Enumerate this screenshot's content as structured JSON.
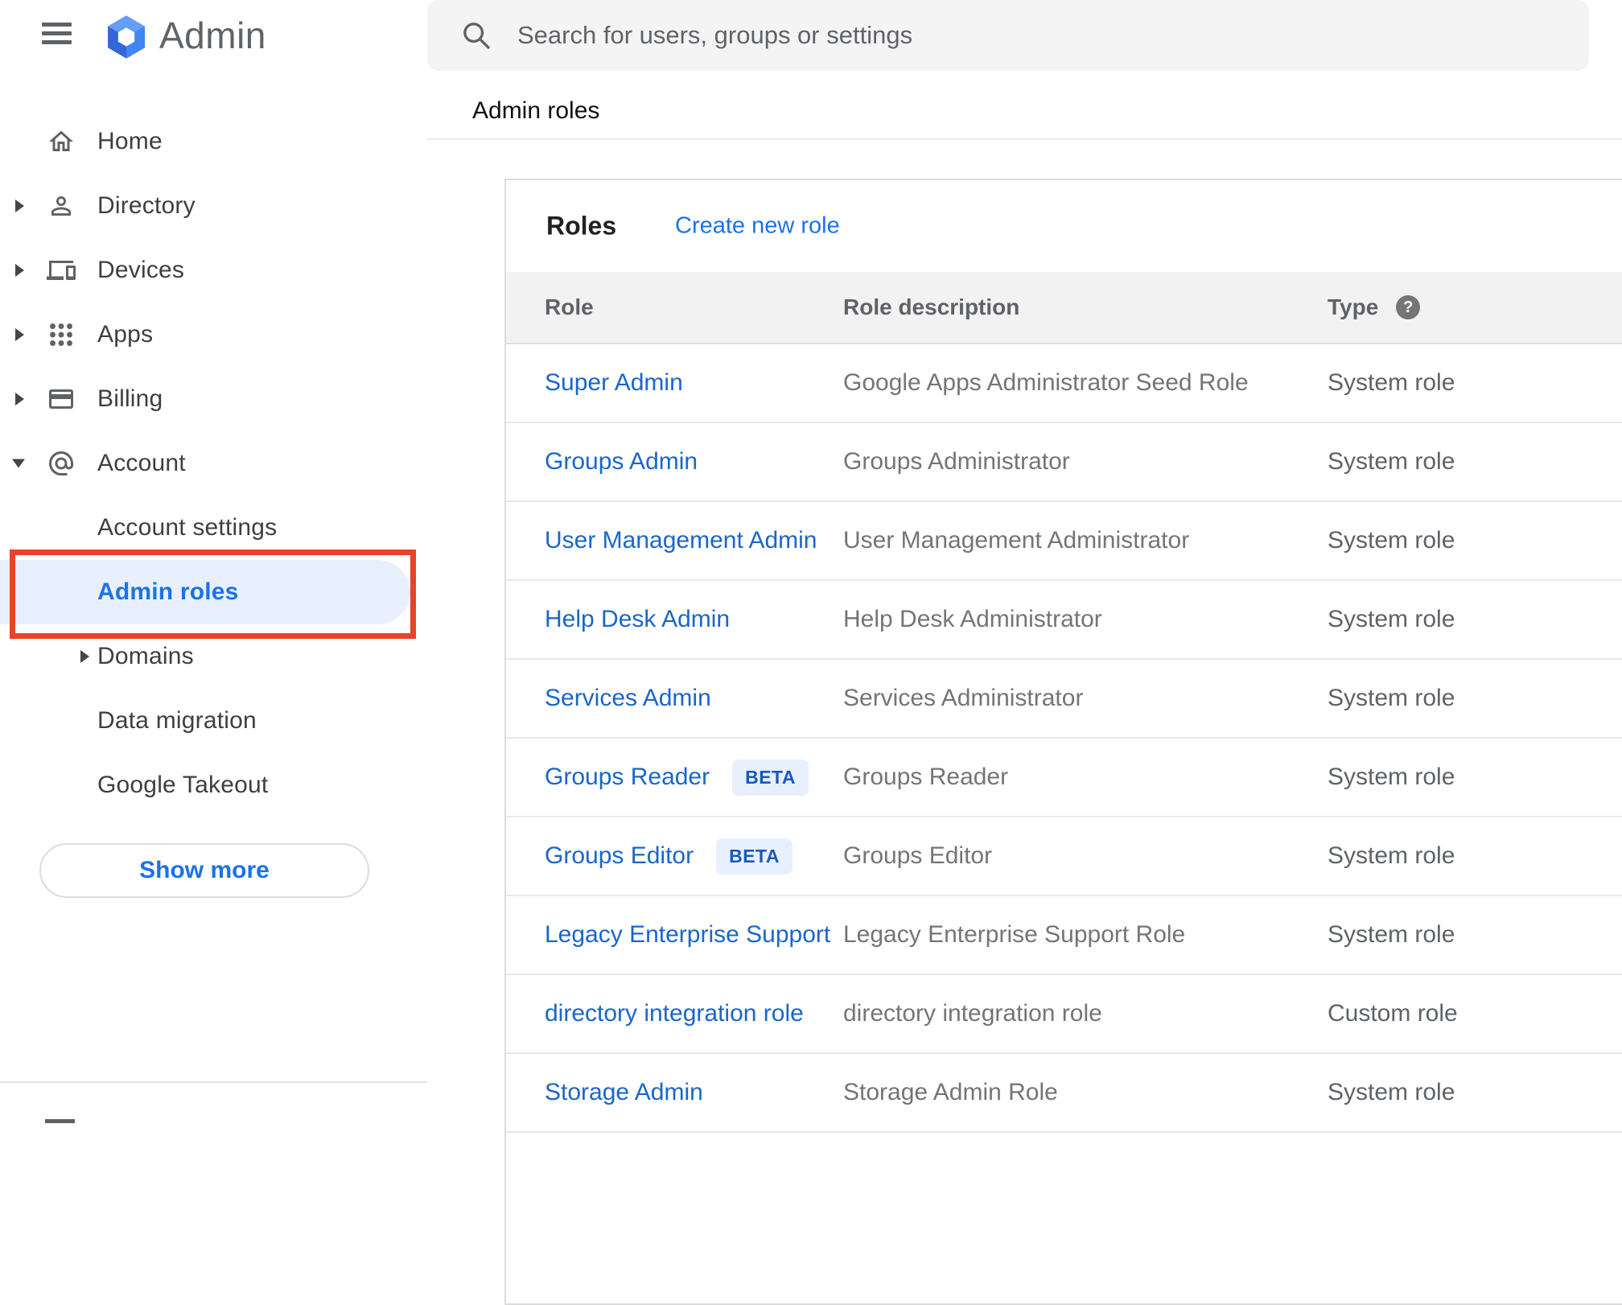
{
  "app": {
    "title": "Admin"
  },
  "search": {
    "placeholder": "Search for users, groups or settings"
  },
  "breadcrumb": "Admin roles",
  "sidebar": {
    "items": [
      {
        "label": "Home",
        "icon": "home-icon",
        "expandable": false
      },
      {
        "label": "Directory",
        "icon": "person-icon",
        "expandable": true
      },
      {
        "label": "Devices",
        "icon": "devices-icon",
        "expandable": true
      },
      {
        "label": "Apps",
        "icon": "apps-grid-icon",
        "expandable": true
      },
      {
        "label": "Billing",
        "icon": "credit-card-icon",
        "expandable": true
      },
      {
        "label": "Account",
        "icon": "at-email-icon",
        "expanded": true
      }
    ],
    "account_children": [
      {
        "label": "Account settings"
      },
      {
        "label": "Admin roles",
        "active": true
      },
      {
        "label": "Domains",
        "expandable": true
      },
      {
        "label": "Data migration"
      },
      {
        "label": "Google Takeout"
      }
    ],
    "show_more_label": "Show more"
  },
  "main": {
    "card_title": "Roles",
    "create_link": "Create new role",
    "table": {
      "columns": [
        "Role",
        "Role description",
        "Type"
      ],
      "beta_label": "BETA",
      "rows": [
        {
          "role": "Super Admin",
          "beta": false,
          "description": "Google Apps Administrator Seed Role",
          "type": "System role"
        },
        {
          "role": "Groups Admin",
          "beta": false,
          "description": "Groups Administrator",
          "type": "System role"
        },
        {
          "role": "User Management Admin",
          "beta": false,
          "description": "User Management Administrator",
          "type": "System role"
        },
        {
          "role": "Help Desk Admin",
          "beta": false,
          "description": "Help Desk Administrator",
          "type": "System role"
        },
        {
          "role": "Services Admin",
          "beta": false,
          "description": "Services Administrator",
          "type": "System role"
        },
        {
          "role": "Groups Reader",
          "beta": true,
          "description": "Groups Reader",
          "type": "System role"
        },
        {
          "role": "Groups Editor",
          "beta": true,
          "description": "Groups Editor",
          "type": "System role"
        },
        {
          "role": "Legacy Enterprise Support",
          "beta": false,
          "description": "Legacy Enterprise Support Role",
          "type": "System role"
        },
        {
          "role": "directory integration role",
          "beta": false,
          "description": "directory integration role",
          "type": "Custom role"
        },
        {
          "role": "Storage Admin",
          "beta": false,
          "description": "Storage Admin Role",
          "type": "System role"
        }
      ]
    }
  },
  "icons": [
    "menu-icon",
    "admin-logo",
    "home-icon",
    "person-icon",
    "devices-icon",
    "apps-grid-icon",
    "credit-card-icon",
    "at-email-icon",
    "search-icon",
    "help-icon",
    "expand-right-icon",
    "expand-down-icon"
  ],
  "colors": {
    "accent-blue": "#1a73e8",
    "role-link-blue": "#1b66c9",
    "highlight-bg": "#e8f0fe",
    "beta-bg": "#e8f0fe",
    "beta-text": "#185abc",
    "annotation-red": "#e8432a",
    "header-bg": "#f2f2f2",
    "search-bg": "#f4f4f4"
  }
}
